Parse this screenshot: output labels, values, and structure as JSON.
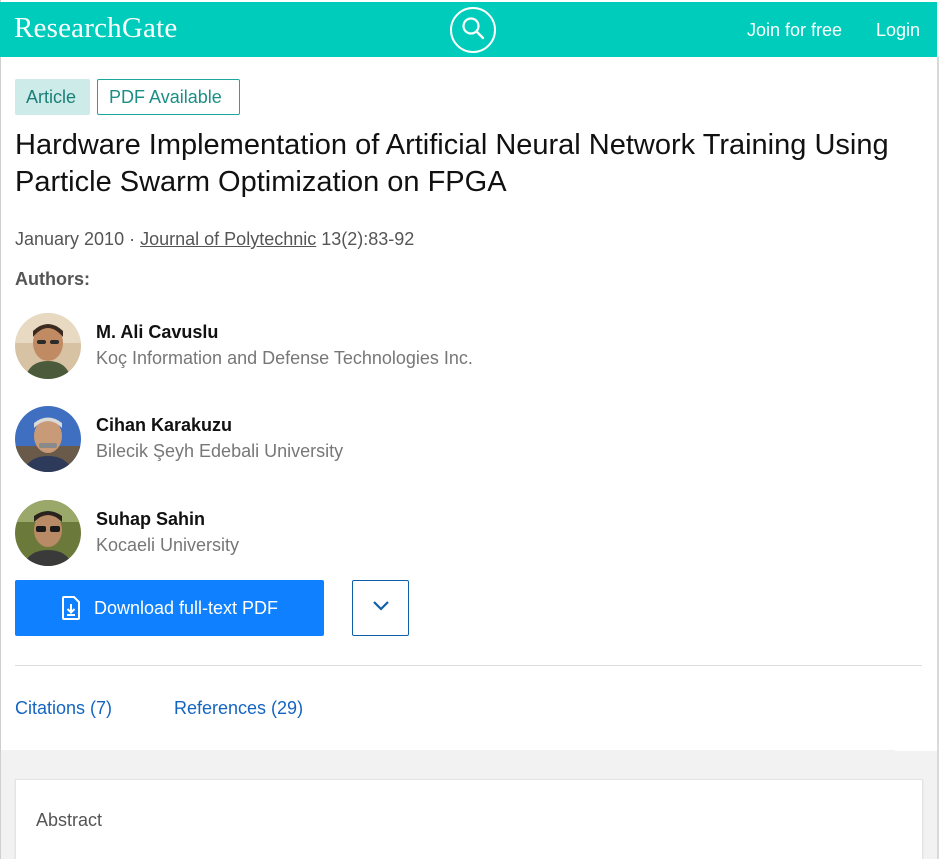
{
  "header": {
    "logo": "ResearchGate",
    "search_icon": "search-icon",
    "join_label": "Join for free",
    "login_label": "Login",
    "brand_color": "#00ccbb"
  },
  "badges": {
    "article": "Article",
    "pdf": "PDF Available"
  },
  "article": {
    "title": "Hardware Implementation of Artificial Neural Network Training Using Particle Swarm Optimization on FPGA",
    "date": "January 2010",
    "separator": "·",
    "journal": "Journal of Polytechnic",
    "volume": "13(2):83-92"
  },
  "authors_label": "Authors:",
  "authors": [
    {
      "name": "M. Ali Cavuslu",
      "institution": "Koç Information and Defense Technologies Inc."
    },
    {
      "name": "Cihan Karakuzu",
      "institution": "Bilecik Şeyh Edebali University"
    },
    {
      "name": "Suhap Sahin",
      "institution": "Kocaeli University"
    }
  ],
  "actions": {
    "download_label": "Download full-text PDF",
    "download_icon": "pdf-download-icon",
    "more_icon": "chevron-down-icon",
    "accent_color": "#0f80ff"
  },
  "tabs": {
    "citations": "Citations (7)",
    "references": "References (29)"
  },
  "abstract": {
    "label": "Abstract"
  }
}
